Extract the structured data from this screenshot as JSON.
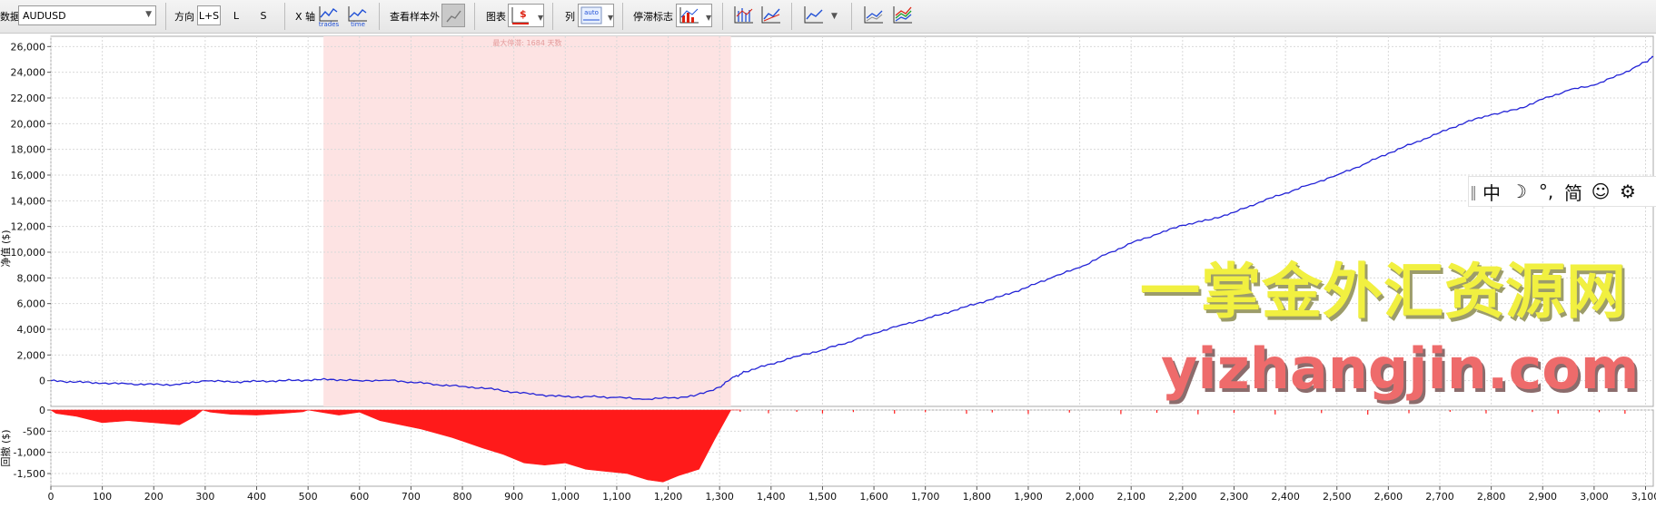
{
  "toolbar": {
    "data_label": "数据",
    "symbol": "AUDUSD",
    "direction_label": "方向",
    "dir_options": [
      "L+S",
      "L",
      "S"
    ],
    "xaxis_label": "X 轴",
    "xaxis_btn1": "trades",
    "xaxis_btn2": "time",
    "oos_label": "查看样本外",
    "chart_label": "图表",
    "column_label": "列",
    "column_btn": "auto",
    "stop_label": "停滞标志"
  },
  "ime": {
    "items": [
      "中",
      "☽",
      "°,",
      "简",
      "☺",
      "⚙"
    ]
  },
  "watermark": {
    "cn": "一掌金外汇资源网",
    "url": "yizhangjin.com"
  },
  "colors": {
    "equity": "#2323d6",
    "drawdown": "#ff1a1a",
    "stagnation": "#fde3e3",
    "grid": "#d9d9d9"
  },
  "chart_data": [
    {
      "type": "line",
      "ylabel": "净值 ($)",
      "xlim": [
        0,
        3115
      ],
      "ylim": [
        -2000,
        26800
      ],
      "yticks": [
        0,
        2000,
        4000,
        6000,
        8000,
        10000,
        12000,
        14000,
        16000,
        18000,
        20000,
        22000,
        24000,
        26000
      ],
      "ytick_labels": [
        "0",
        "2,000",
        "4,000",
        "6,000",
        "8,000",
        "10,000",
        "12,000",
        "14,000",
        "16,000",
        "18,000",
        "20,000",
        "22,000",
        "24,000",
        "26,000"
      ],
      "grid": true,
      "stagnation": {
        "start": 530,
        "end": 1322,
        "label": "最大停滞: 1684 天数"
      },
      "series": [
        {
          "x": [
            0,
            50,
            100,
            150,
            200,
            250,
            300,
            350,
            400,
            450,
            500,
            550,
            600,
            650,
            700,
            750,
            800,
            850,
            900,
            950,
            1000,
            1050,
            1100,
            1150,
            1200,
            1250,
            1300,
            1322,
            1350,
            1400,
            1450,
            1500,
            1550,
            1600,
            1650,
            1700,
            1750,
            1800,
            1850,
            1900,
            1950,
            2000,
            2050,
            2100,
            2150,
            2200,
            2250,
            2300,
            2350,
            2400,
            2450,
            2500,
            2550,
            2600,
            2650,
            2700,
            2750,
            2800,
            2850,
            2900,
            2950,
            3000,
            3050,
            3100,
            3115
          ],
          "y": [
            0,
            -100,
            -200,
            -250,
            -300,
            -300,
            0,
            -100,
            -50,
            0,
            50,
            100,
            0,
            50,
            -100,
            -300,
            -450,
            -600,
            -900,
            -1100,
            -1250,
            -1250,
            -1300,
            -1450,
            -1350,
            -1200,
            -500,
            150,
            700,
            1300,
            1900,
            2400,
            3000,
            3700,
            4300,
            4800,
            5400,
            6000,
            6600,
            7300,
            8100,
            8800,
            9800,
            10700,
            11400,
            12100,
            12500,
            13100,
            13900,
            14600,
            15300,
            16000,
            16800,
            17700,
            18500,
            19300,
            20100,
            20700,
            21100,
            21900,
            22600,
            23000,
            23800,
            24800,
            25200
          ]
        }
      ]
    },
    {
      "type": "area",
      "ylabel": "回撤 ($)",
      "xlabel": "",
      "xlim": [
        0,
        3115
      ],
      "ylim": [
        -1800,
        0
      ],
      "yticks": [
        0,
        -500,
        -1000,
        -1500
      ],
      "ytick_labels": [
        "0",
        "-500",
        "-1,000",
        "-1,500"
      ],
      "xticks": [
        0,
        100,
        200,
        300,
        400,
        500,
        600,
        700,
        800,
        900,
        1000,
        1100,
        1200,
        1300,
        1400,
        1500,
        1600,
        1700,
        1800,
        1900,
        2000,
        2100,
        2200,
        2300,
        2400,
        2500,
        2600,
        2700,
        2800,
        2900,
        3000,
        3100
      ],
      "xtick_labels": [
        "0",
        "100",
        "200",
        "300",
        "400",
        "500",
        "600",
        "700",
        "800",
        "900",
        "1,000",
        "1,100",
        "1,200",
        "1,300",
        "1,400",
        "1,500",
        "1,600",
        "1,700",
        "1,800",
        "1,900",
        "2,000",
        "2,100",
        "2,200",
        "2,300",
        "2,400",
        "2,500",
        "2,600",
        "2,700",
        "2,800",
        "2,900",
        "3,000",
        "3,100"
      ],
      "grid": true,
      "series": [
        {
          "x": [
            0,
            10,
            50,
            100,
            150,
            200,
            250,
            280,
            295,
            310,
            350,
            400,
            450,
            490,
            500,
            530,
            560,
            600,
            640,
            680,
            720,
            780,
            840,
            880,
            920,
            960,
            1000,
            1040,
            1080,
            1120,
            1160,
            1190,
            1220,
            1260,
            1290,
            1322,
            1340
          ],
          "y": [
            0,
            -80,
            -150,
            -300,
            -250,
            -300,
            -350,
            -150,
            0,
            -50,
            -100,
            -120,
            -80,
            -40,
            0,
            -60,
            -120,
            -50,
            -250,
            -350,
            -450,
            -650,
            -900,
            -1050,
            -1250,
            -1300,
            -1250,
            -1400,
            -1450,
            -1500,
            -1650,
            -1700,
            -1550,
            -1400,
            -700,
            0,
            0
          ]
        }
      ]
    }
  ]
}
